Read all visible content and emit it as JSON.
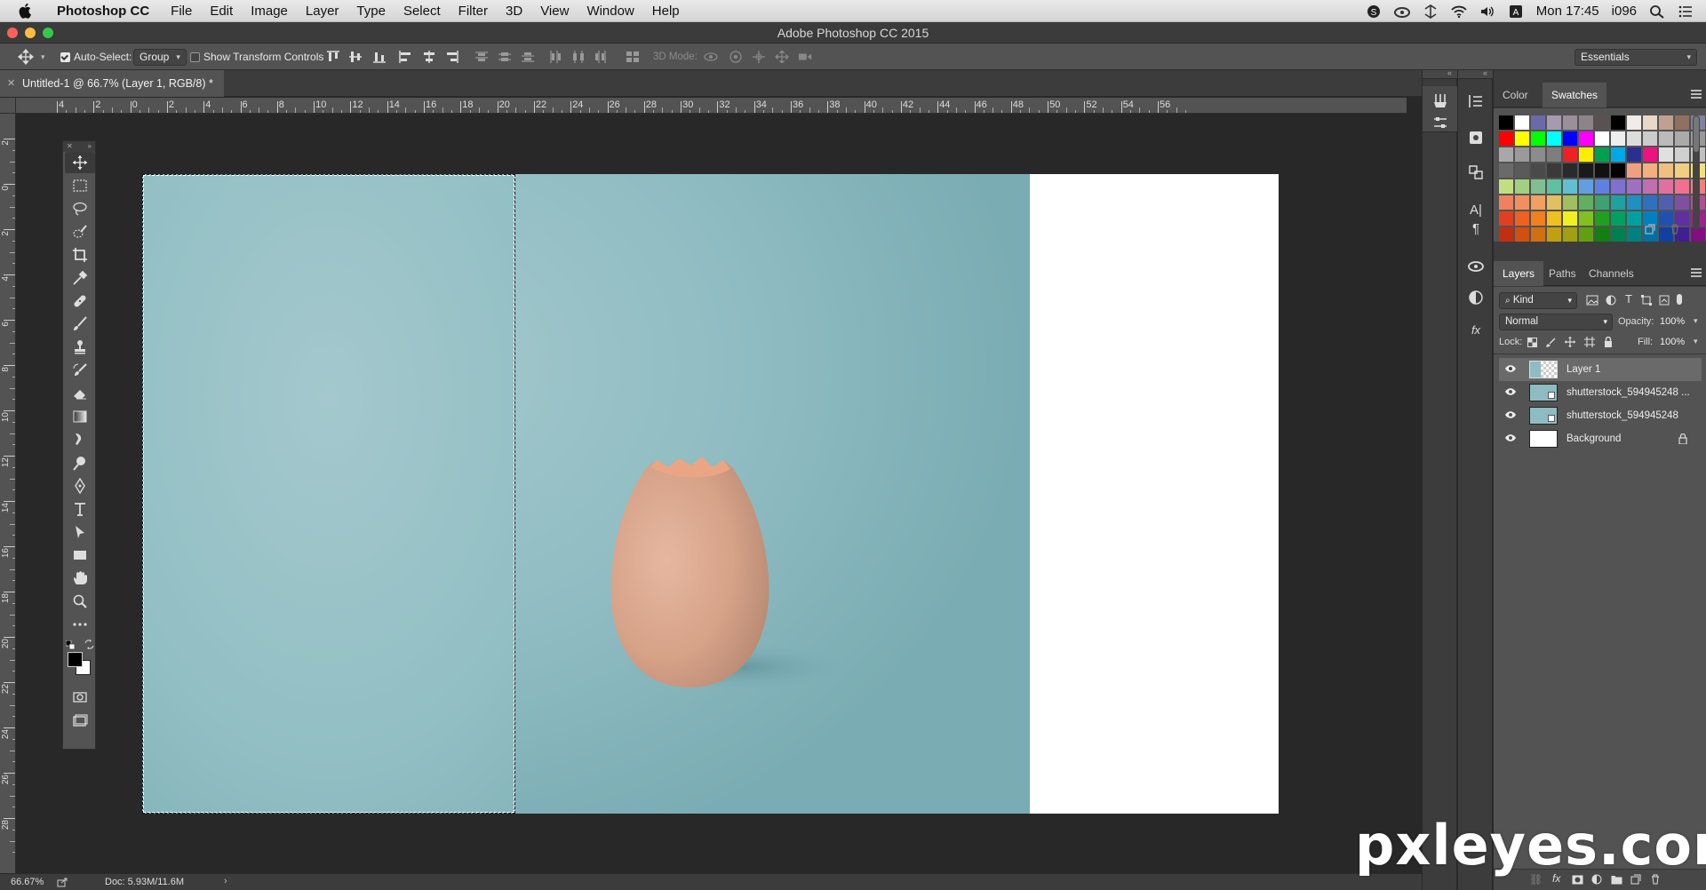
{
  "menubar": {
    "app_name": "Photoshop CC",
    "items": [
      "File",
      "Edit",
      "Image",
      "Layer",
      "Type",
      "Select",
      "Filter",
      "3D",
      "View",
      "Window",
      "Help"
    ],
    "clock": "Mon 17:45",
    "user": "i096"
  },
  "window": {
    "title": "Adobe Photoshop CC 2015"
  },
  "options": {
    "auto_select_label": "Auto-Select:",
    "auto_select_checked": true,
    "auto_select_value": "Group",
    "transform_controls_label": "Show Transform Controls",
    "mode_3d_label": "3D Mode:",
    "workspace": "Essentials"
  },
  "document": {
    "tab_title": "Untitled-1 @ 66.7% (Layer 1, RGB/8) *",
    "zoom": "66.67%",
    "doc_info": "Doc: 5.93M/11.6M"
  },
  "ruler": {
    "top_labels": [
      "4",
      "2",
      "0",
      "2",
      "4",
      "6",
      "8",
      "10",
      "12",
      "14",
      "16",
      "18",
      "20",
      "22",
      "24",
      "26",
      "28",
      "30",
      "32",
      "34",
      "36",
      "38",
      "40",
      "42",
      "44",
      "46",
      "48",
      "50",
      "52",
      "54",
      "56"
    ],
    "left_labels": [
      "2",
      "0",
      "2",
      "4",
      "6",
      "8",
      "10",
      "12",
      "14",
      "16",
      "18",
      "20",
      "22",
      "24",
      "26",
      "28"
    ]
  },
  "color_panel": {
    "tabs": [
      "Color",
      "Swatches"
    ],
    "active_tab": "Swatches",
    "swatches": [
      "#000000",
      "#ffffff",
      "#6b6aa8",
      "#a69ab0",
      "#9a8f9a",
      "#8c8488",
      "#5a5252",
      "#000000",
      "#f0ede9",
      "#e8d8c8",
      "#c0a090",
      "#907060",
      "#8080a0",
      "#3050a0",
      "#ff0000",
      "#ffff00",
      "#00ff00",
      "#00ffff",
      "#0000ff",
      "#ff00ff",
      "#ffffff",
      "#eeeeee",
      "#dddddd",
      "#cccccc",
      "#bbbbbb",
      "#aaaaaa",
      "#999999",
      "#888888",
      "#a8a8a8",
      "#9a9a9a",
      "#8c8c8c",
      "#7e7e7e",
      "#ee2222",
      "#ffee00",
      "#00a050",
      "#00a8e8",
      "#2a3090",
      "#ee1180",
      "#e0e0e0",
      "#d0d0d0",
      "#c0c0c0",
      "#b0b0b0",
      "#6a6a6a",
      "#5a5a5a",
      "#4a4a4a",
      "#3a3a3a",
      "#2a2a2a",
      "#1a1a1a",
      "#111111",
      "#000000",
      "#f0a080",
      "#f0b080",
      "#f0c080",
      "#f0d080",
      "#f0e080",
      "#f0f080",
      "#c0e080",
      "#a0d080",
      "#80c090",
      "#60c0a0",
      "#60c0d0",
      "#60a0e0",
      "#6080e0",
      "#8070d0",
      "#a070c0",
      "#c070b0",
      "#e070a0",
      "#f07090",
      "#f08080",
      "#f09080",
      "#f08060",
      "#f09060",
      "#f0a060",
      "#e0c060",
      "#a0c060",
      "#60b060",
      "#40a070",
      "#20a0a0",
      "#2090c0",
      "#3070c0",
      "#5060b0",
      "#8050a0",
      "#b05090",
      "#d05070",
      "#e04020",
      "#f06020",
      "#f08020",
      "#f0c020",
      "#f0f020",
      "#80c020",
      "#20a020",
      "#00a060",
      "#00a0a0",
      "#0080c0",
      "#2050b0",
      "#6030a0",
      "#a02090",
      "#d01060",
      "#c03010",
      "#d05010",
      "#d07010",
      "#c0a010",
      "#a0a010",
      "#60a010",
      "#108010",
      "#008050",
      "#008080",
      "#0070a0",
      "#1040a0",
      "#402090",
      "#801080",
      "#b00050"
    ]
  },
  "layers_panel": {
    "tabs": [
      "Layers",
      "Paths",
      "Channels"
    ],
    "active_tab": "Layers",
    "filter_kind": "Kind",
    "blend_mode": "Normal",
    "opacity_label": "Opacity:",
    "opacity": "100%",
    "lock_label": "Lock:",
    "fill_label": "Fill:",
    "fill": "100%",
    "layers": [
      {
        "name": "Layer 1",
        "selected": true
      },
      {
        "name": "shutterstock_594945248 ...",
        "selected": false
      },
      {
        "name": "shutterstock_594945248",
        "selected": false
      },
      {
        "name": "Background",
        "selected": false
      }
    ]
  },
  "watermark": "pxleyes.com",
  "colors": {
    "photo_bg": "#8fbcc2",
    "egg": "#d9a88e",
    "egg_inside": "#e8aa88"
  }
}
